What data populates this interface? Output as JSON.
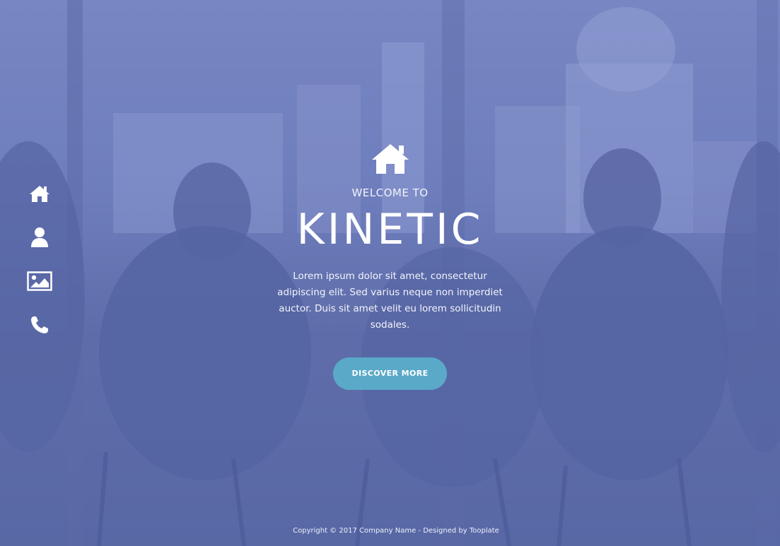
{
  "nav": {
    "items": [
      {
        "icon": "home-icon"
      },
      {
        "icon": "user-icon"
      },
      {
        "icon": "image-icon"
      },
      {
        "icon": "phone-icon"
      }
    ]
  },
  "hero": {
    "icon": "home-icon",
    "welcome": "WELCOME TO",
    "title": "KINETIC",
    "description": "Lorem ipsum dolor sit amet, consectetur adipiscing elit. Sed varius neque non imperdiet auctor. Duis sit amet velit eu lorem sollicitudin sodales.",
    "cta_label": "DISCOVER MORE"
  },
  "footer": {
    "copyright": "Copyright © 2017 Company Name - Designed by ",
    "designer": "Tooplate"
  },
  "colors": {
    "overlay": "#6473b0",
    "cta": "#5aa9c9",
    "text": "#ffffff"
  }
}
